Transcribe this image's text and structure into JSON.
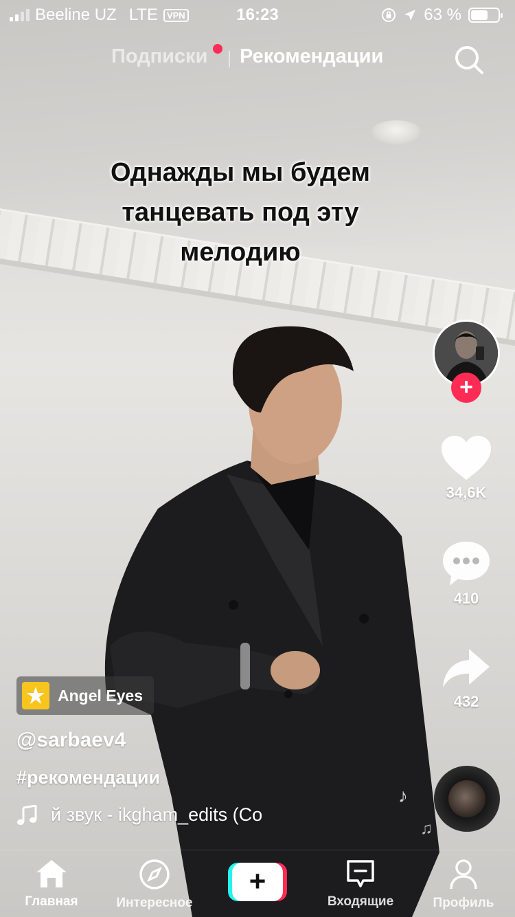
{
  "status_bar": {
    "carrier": "Beeline UZ",
    "network": "LTE",
    "vpn": "VPN",
    "time": "16:23",
    "battery": "63 %",
    "battery_level": 0.63
  },
  "top_nav": {
    "tabs": [
      {
        "label": "Подписки",
        "active": false,
        "has_dot": true
      },
      {
        "label": "Рекомендации",
        "active": true
      }
    ],
    "search_icon": "search-icon"
  },
  "video": {
    "overlay_text": "Однажды мы будем танцевать под эту мелодию"
  },
  "actions": {
    "like_count": "34,6K",
    "comment_count": "410",
    "share_count": "432",
    "follow_icon": "plus-icon"
  },
  "effect": {
    "label": "Angel Eyes",
    "icon": "effect-icon"
  },
  "post": {
    "username": "@sarbaev4",
    "hashtag": "#рекомендации",
    "music": "й звук - ikgham_edits (Co"
  },
  "tab_bar": {
    "items": [
      {
        "label": "Главная",
        "icon": "home-icon",
        "active": true
      },
      {
        "label": "Интересное",
        "icon": "compass-icon"
      },
      {
        "label": "",
        "icon": "plus-icon"
      },
      {
        "label": "Входящие",
        "icon": "inbox-icon"
      },
      {
        "label": "Профиль",
        "icon": "profile-icon"
      }
    ]
  },
  "colors": {
    "accent": "#fe2c55",
    "cyan": "#25f4ee"
  }
}
